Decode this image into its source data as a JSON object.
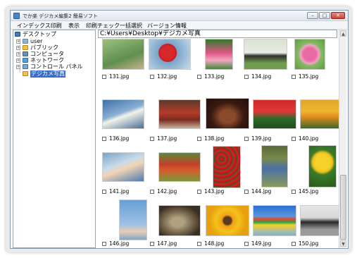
{
  "window": {
    "title": "でか楽 デジカメ編集2 簡易ソフト"
  },
  "menu": [
    "インデックス印刷",
    "表示",
    "印刷チェック一括選択",
    "バージョン情報"
  ],
  "tree": [
    {
      "label": "デスクトップ",
      "icon": "desktop-icon"
    },
    {
      "label": "user",
      "icon": "user-folder-icon"
    },
    {
      "label": "パブリック",
      "icon": "folder-icon"
    },
    {
      "label": "コンピュータ",
      "icon": "computer-icon"
    },
    {
      "label": "ネットワーク",
      "icon": "network-icon"
    },
    {
      "label": "コントロール パネル",
      "icon": "control-panel-icon"
    },
    {
      "label": "デジカメ写真",
      "icon": "folder-icon",
      "selected": true
    }
  ],
  "path": "C:¥Users¥Desktop¥デジカメ写真",
  "files": [
    "131.jpg",
    "132.jpg",
    "133.jpg",
    "134.jpg",
    "135.jpg",
    "136.jpg",
    "137.jpg",
    "138.jpg",
    "139.jpg",
    "140.jpg",
    "141.jpg",
    "142.jpg",
    "143.jpg",
    "144.jpg",
    "145.jpg",
    "146.jpg",
    "147.jpg",
    "148.jpg",
    "149.jpg",
    "150.jpg"
  ],
  "colors": {
    "selection": "#3a6fc8",
    "close_button": "#c8473a"
  }
}
